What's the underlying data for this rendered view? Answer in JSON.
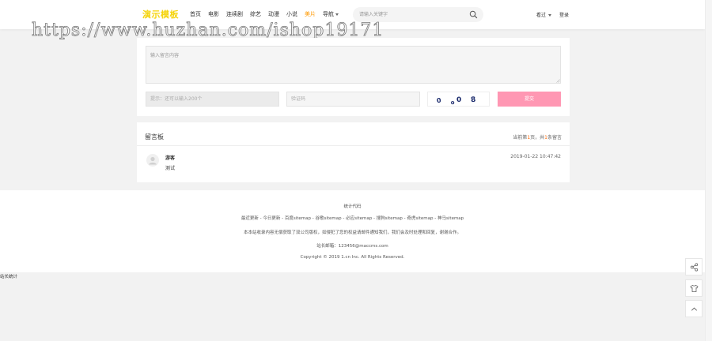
{
  "header": {
    "logo": "演示模板",
    "nav": [
      {
        "label": "首页",
        "active": false
      },
      {
        "label": "电影",
        "active": false
      },
      {
        "label": "连续剧",
        "active": false
      },
      {
        "label": "综艺",
        "active": false
      },
      {
        "label": "动漫",
        "active": false
      },
      {
        "label": "小说",
        "active": false
      },
      {
        "label": "美片",
        "active": true
      },
      {
        "label": "导航",
        "active": false
      }
    ],
    "search_placeholder": "请输入关键字",
    "history_label": "看过",
    "login_label": "登录"
  },
  "watermark": "https://www.huzhan.com/ishop19171",
  "form": {
    "message_placeholder": "输入留言内容",
    "nickname_placeholder": "提示：还可以输入200个",
    "captcha_placeholder": "验证码",
    "captcha_text": "0 08",
    "submit_label": "提交"
  },
  "board": {
    "title": "留言板",
    "meta_prefix": "当前第",
    "page": "1",
    "meta_mid": "页，共",
    "count": "1",
    "meta_suffix": "条留言",
    "items": [
      {
        "user": "游客",
        "content": "测试",
        "time": "2019-01-22 10:47:42"
      }
    ]
  },
  "footer": {
    "stat_label": "统计代码",
    "sitemaps": [
      "最近更新",
      "今日更新",
      "百度sitemap",
      "谷歌sitemap",
      "必应sitemap",
      "搜狗sitemap",
      "奇虎sitemap",
      "神马sitemap"
    ],
    "sitemap_sep": " - ",
    "notice": "本本站收录内容无偿获取了双公司版权，如侵犯了您的权益请邮件通知我们，我们会及时处理和回复，谢谢合作。",
    "email": "站长邮箱：123456@maccms.com",
    "copyright": "Copyright © 2019 1.cn Inc. All Rights Reserved."
  },
  "site_stats": "站长统计",
  "colors": {
    "logo": "#f5d40c",
    "nav_active": "#ff9900",
    "submit_bg": "#ff97b3",
    "count_highlight": "#ff6600"
  }
}
